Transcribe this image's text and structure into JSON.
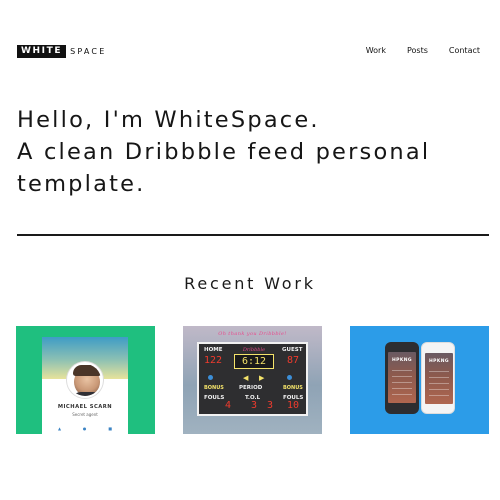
{
  "header": {
    "logo_dark": "WHITE",
    "logo_light": "SPACE",
    "nav": [
      {
        "label": "Work"
      },
      {
        "label": "Posts"
      },
      {
        "label": "Contact"
      }
    ]
  },
  "hero": {
    "lines": [
      "Hello, I'm WhiteSpace.",
      "A clean Dribbble feed personal",
      "template."
    ]
  },
  "section": {
    "title": "Recent Work"
  },
  "cards": [
    {
      "name": "MICHAEL SCARN",
      "subtitle": "Secret agent"
    },
    {
      "tagline": "Oh thank you Dribbble!",
      "board_brand": "Dribbble",
      "labels": {
        "home": "HOME",
        "guest": "GUEST",
        "bonus_left": "BONUS",
        "bonus_right": "BONUS",
        "period": "PERIOD",
        "fouls_left": "FOULS",
        "tol": "T.O.L",
        "fouls_right": "FOULS"
      },
      "values": {
        "home": "122",
        "clock": "6:12",
        "guest": "87",
        "fouls_home": "4",
        "period": "3",
        "tol": "3",
        "fouls_guest": "10"
      }
    },
    {
      "app_name": "HPKNG"
    }
  ],
  "colors": {
    "card1_bg": "#1fbf7f",
    "card3_bg": "#2c9ce8",
    "text": "#1c1c1c"
  }
}
